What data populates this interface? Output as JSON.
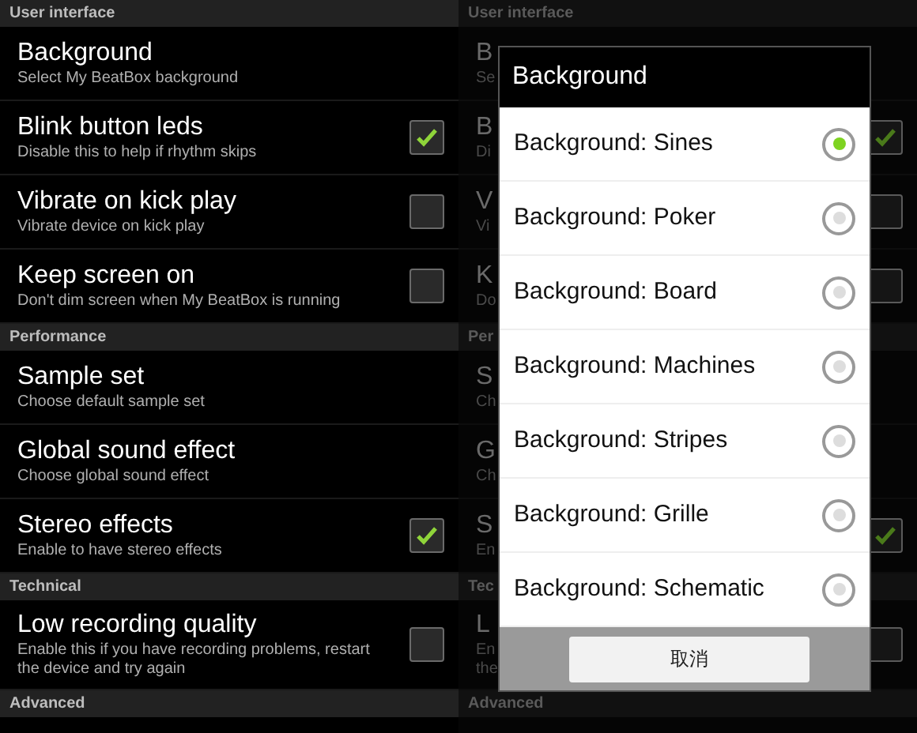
{
  "screens": [
    {
      "dimmed": false,
      "sections": [
        {
          "header": "User interface",
          "items": [
            {
              "kind": "plain",
              "title": "Background",
              "summary": [
                "Select My BeatBox background"
              ]
            },
            {
              "kind": "checkbox",
              "title": "Blink button leds",
              "summary": [
                "Disable this to help if rhythm skips"
              ],
              "checked": true
            },
            {
              "kind": "checkbox",
              "title": "Vibrate on kick play",
              "summary": [
                "Vibrate device on kick play"
              ],
              "checked": false
            },
            {
              "kind": "checkbox",
              "title": "Keep screen on",
              "summary": [
                "Don't dim screen when My BeatBox is running"
              ],
              "checked": false
            }
          ]
        },
        {
          "header": "Performance",
          "items": [
            {
              "kind": "plain",
              "title": "Sample set",
              "summary": [
                "Choose default sample set"
              ]
            },
            {
              "kind": "plain",
              "title": "Global sound effect",
              "summary": [
                "Choose global sound effect"
              ]
            },
            {
              "kind": "checkbox",
              "title": "Stereo effects",
              "summary": [
                "Enable to have stereo effects"
              ],
              "checked": true
            }
          ]
        },
        {
          "header": "Technical",
          "items": [
            {
              "kind": "checkbox",
              "title": "Low recording quality",
              "summary": [
                "Enable this if you have recording problems, restart",
                "the device and try again"
              ],
              "checked": false
            }
          ]
        },
        {
          "header": "Advanced"
        }
      ]
    },
    {
      "dimmed": true,
      "sections": [
        {
          "header": "User interface",
          "items": [
            {
              "kind": "plain",
              "title": "B",
              "summary": [
                "Se"
              ]
            },
            {
              "kind": "checkbox",
              "title": "B",
              "summary": [
                "Di"
              ],
              "checked": true
            },
            {
              "kind": "checkbox",
              "title": "V",
              "summary": [
                "Vi"
              ],
              "checked": false
            },
            {
              "kind": "checkbox",
              "title": "K",
              "summary": [
                "Do"
              ],
              "checked": false
            }
          ]
        },
        {
          "header": "Per",
          "items": [
            {
              "kind": "plain",
              "title": "S",
              "summary": [
                "Ch"
              ]
            },
            {
              "kind": "plain",
              "title": "G",
              "summary": [
                "Ch"
              ]
            },
            {
              "kind": "checkbox",
              "title": "S",
              "summary": [
                "En"
              ],
              "checked": true
            }
          ]
        },
        {
          "header": "Tec",
          "items": [
            {
              "kind": "checkbox",
              "title": "L",
              "summary": [
                "En",
                "the"
              ],
              "checked": false
            }
          ]
        },
        {
          "header": "Advanced"
        }
      ]
    }
  ],
  "dialog": {
    "title": "Background",
    "options": [
      {
        "label": "Background: Sines",
        "selected": true
      },
      {
        "label": "Background: Poker",
        "selected": false
      },
      {
        "label": "Background: Board",
        "selected": false
      },
      {
        "label": "Background: Machines",
        "selected": false
      },
      {
        "label": "Background: Stripes",
        "selected": false
      },
      {
        "label": "Background: Grille",
        "selected": false
      },
      {
        "label": "Background: Schematic",
        "selected": false
      }
    ],
    "cancel": "取消"
  }
}
